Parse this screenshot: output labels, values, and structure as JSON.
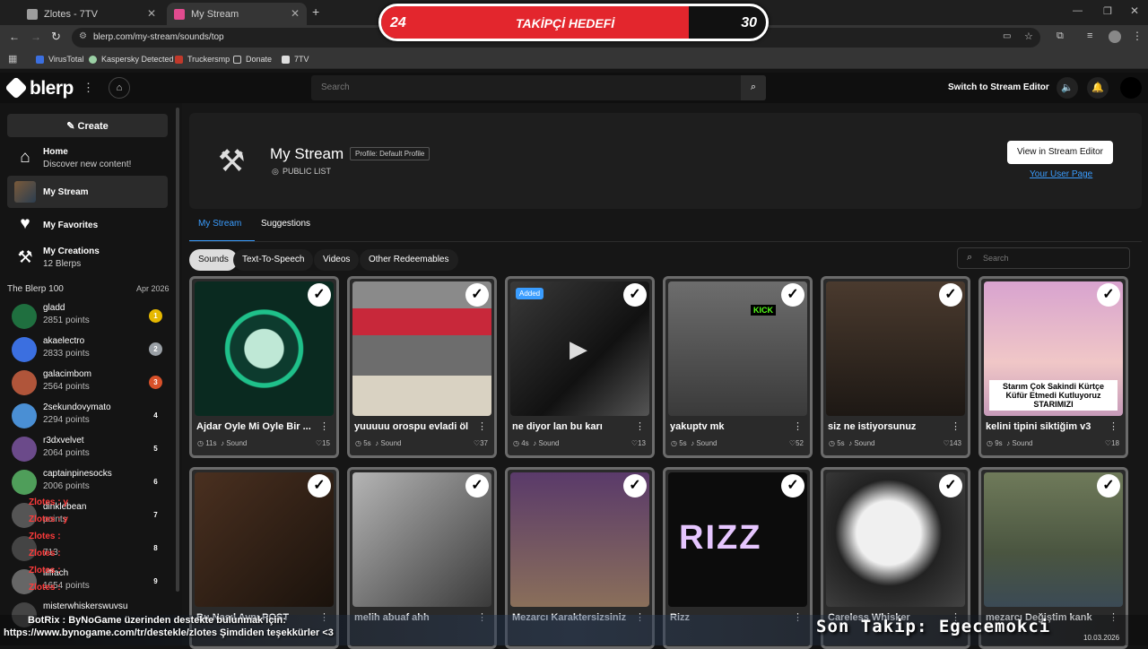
{
  "browser": {
    "tabs": [
      {
        "label": "Zlotes - 7TV",
        "active": false
      },
      {
        "label": "My Stream",
        "active": true
      }
    ],
    "new_tab_symbol": "+",
    "url": "blerp.com/my-stream/sounds/top",
    "bookmarks": [
      "VirusTotal",
      "Kaspersky Detected",
      "Truckersmp",
      "Donate",
      "7TV"
    ]
  },
  "overlay": {
    "goal_label": "TAKİPÇİ HEDEFİ",
    "goal_current": "24",
    "goal_target": "30",
    "goal_fraction": 0.8,
    "ticker_botrix": "BotRix : ByNoGame üzerinden destekte bulunmak için:",
    "ticker_url": "https://www.bynogame.com/tr/destekle/zlotes Şimdiden teşekkürler <3",
    "last_follow": "Son Takip: Egecemokci",
    "date": "10.03.2026",
    "chat_lines": [
      "Zlotes : y",
      "Zlotes : y",
      "Zlotes :",
      "Zlotes :",
      "Zlotes :",
      "Zlotes :"
    ]
  },
  "nav": {
    "logo": "blerp",
    "search_placeholder": "Search",
    "switch_label": "Switch to Stream Editor"
  },
  "sidebar": {
    "create_label": "Create",
    "items": [
      {
        "title": "Home",
        "subtitle": "Discover new content!"
      },
      {
        "title": "My Stream",
        "subtitle": ""
      },
      {
        "title": "My Favorites",
        "subtitle": ""
      },
      {
        "title": "My Creations",
        "subtitle": "12 Blerps"
      }
    ],
    "leaderboard_title": "The Blerp 100",
    "leaderboard_date": "Apr 2026",
    "leaderboard": [
      {
        "name": "gladd",
        "points": "2851 points",
        "rank": "1",
        "color": "#e6b800"
      },
      {
        "name": "akaelectro",
        "points": "2833 points",
        "rank": "2",
        "color": "#9aa0a6"
      },
      {
        "name": "galacimbom",
        "points": "2564 points",
        "rank": "3",
        "color": "#d8512a"
      },
      {
        "name": "2sekundovymato",
        "points": "2294 points",
        "rank": "4",
        "color": ""
      },
      {
        "name": "r3dxvelvet",
        "points": "2064 points",
        "rank": "5",
        "color": ""
      },
      {
        "name": "captainpinesocks",
        "points": "2006 points",
        "rank": "6",
        "color": ""
      },
      {
        "name": "dinklebean",
        "points": "points",
        "rank": "7",
        "color": ""
      },
      {
        "name": "",
        "points": "713",
        "rank": "8",
        "color": ""
      },
      {
        "name": "iliffach",
        "points": "1654 points",
        "rank": "9",
        "color": ""
      },
      {
        "name": "misterwhiskerswuvsu",
        "points": "",
        "rank": "",
        "color": ""
      }
    ]
  },
  "main": {
    "title": "My Stream",
    "profile_badge": "Profile: Default Profile",
    "list_visibility": "PUBLIC LIST",
    "view_editor_label": "View in Stream Editor",
    "user_page_link": "Your User Page",
    "tabs": [
      "My Stream",
      "Suggestions"
    ],
    "filters": [
      "Sounds",
      "Text-To-Speech",
      "Videos",
      "Other Redeemables"
    ],
    "search_placeholder": "Search",
    "cards": [
      {
        "title": "Ajdar Oyle Mi Oyle Bir ...",
        "duration": "11s",
        "type": "Sound",
        "likes": "15",
        "added": "",
        "thumb": "wave"
      },
      {
        "title": "yuuuuu orospu evladi öl",
        "duration": "5s",
        "type": "Sound",
        "likes": "37",
        "added": "",
        "thumb": "stadium"
      },
      {
        "title": "ne diyor lan bu karı",
        "duration": "4s",
        "type": "Sound",
        "likes": "13",
        "added": "Added",
        "thumb": "bw"
      },
      {
        "title": "yakuptv mk",
        "duration": "5s",
        "type": "Sound",
        "likes": "52",
        "added": "",
        "thumb": "kick"
      },
      {
        "title": "siz ne istiyorsunuz",
        "duration": "5s",
        "type": "Sound",
        "likes": "143",
        "added": "",
        "thumb": "man"
      },
      {
        "title": "kelini tipini siktiğim v3",
        "duration": "9s",
        "type": "Sound",
        "likes": "18",
        "added": "",
        "thumb": "pink"
      },
      {
        "title": "Bu Nasıl Aynı POST",
        "duration": "",
        "type": "",
        "likes": "",
        "added": "",
        "thumb": "mic"
      },
      {
        "title": "melih abuaf ahh",
        "duration": "",
        "type": "",
        "likes": "",
        "added": "",
        "thumb": "gray"
      },
      {
        "title": "Mezarcı Karaktersizsiniz",
        "duration": "",
        "type": "",
        "likes": "",
        "added": "",
        "thumb": "stream"
      },
      {
        "title": "Rizz",
        "duration": "",
        "type": "",
        "likes": "",
        "added": "",
        "thumb": "rizz"
      },
      {
        "title": "Careless Whisker",
        "duration": "",
        "type": "",
        "likes": "",
        "added": "",
        "thumb": "cat"
      },
      {
        "title": "mezarcı Değiştim kank",
        "duration": "",
        "type": "",
        "likes": "",
        "added": "",
        "thumb": "game"
      }
    ],
    "pink_caption": "Starım Çok Sakindi Kürtçe Küfür Etmedi Kutluyoruz STARIMIZI",
    "kick_text": "KICK",
    "rizz_text": "RIZZ"
  },
  "colors": {
    "accent": "#3a9dff",
    "goal_red": "#e3262d",
    "card_border": "#6b6b6b"
  }
}
